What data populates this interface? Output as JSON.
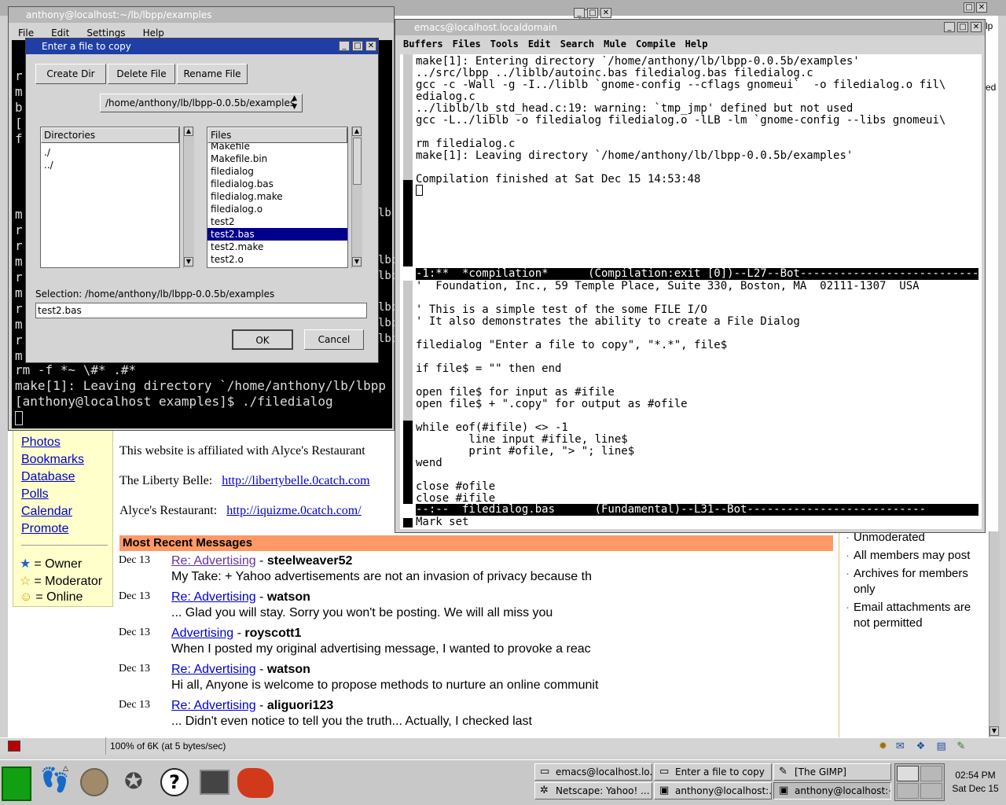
{
  "terminal": {
    "title": "anthony@localhost:~/lb/lbpp/examples",
    "menu": [
      "File",
      "Edit",
      "Settings",
      "Help"
    ],
    "left_chars": [
      "r",
      "m",
      "b",
      "[",
      "f",
      "m",
      "r",
      "r",
      "m",
      "r",
      "m",
      "r",
      "m",
      "r",
      "m"
    ],
    "right_fragments": [
      "lb",
      "lbp",
      "lbp",
      "lbp",
      "lbp",
      "lbp"
    ],
    "lines": [
      "rm -f *~ \\#* .#*",
      "make[1]: Leaving directory `/home/anthony/lb/lbpp",
      "[anthony@localhost examples]$ ./filedialog"
    ]
  },
  "dialog": {
    "title": "Enter a file to copy",
    "buttons": [
      "Create Dir",
      "Delete File",
      "Rename File"
    ],
    "path_select": "/home/anthony/lb/lbpp-0.0.5b/examples",
    "dirs_header": "Directories",
    "dirs": [
      "./",
      "../"
    ],
    "files_header": "Files",
    "files": [
      "Makefile",
      "Makefile.bin",
      "filedialog",
      "filedialog.bas",
      "filedialog.make",
      "filedialog.o",
      "test2",
      "test2.bas",
      "test2.make",
      "test2.o"
    ],
    "selected_file": "test2.bas",
    "selection_label": "Selection: /home/anthony/lb/lbpp-0.0.5b/examples",
    "selection_value": "test2.bas",
    "ok": "OK",
    "cancel": "Cancel"
  },
  "emacs": {
    "title": "emacs@localhost.localdomain",
    "menu": [
      "Buffers",
      "Files",
      "Tools",
      "Edit",
      "Search",
      "Mule",
      "Compile",
      "Help"
    ],
    "compile_lines": [
      "make[1]: Entering directory `/home/anthony/lb/lbpp-0.0.5b/examples'",
      "../src/lbpp ../liblb/autoinc.bas filedialog.bas filedialog.c",
      "gcc -c -Wall -g -I../liblb `gnome-config --cflags gnomeui`  -o filedialog.o fil\\",
      "edialog.c",
      "../liblb/lb_std_head.c:19: warning: `tmp_jmp' defined but not used",
      "gcc -L../liblb -o filedialog filedialog.o -lLB -lm `gnome-config --libs gnomeui\\",
      "",
      "rm filedialog.c",
      "make[1]: Leaving directory `/home/anthony/lb/lbpp-0.0.5b/examples'",
      "",
      "Compilation finished at Sat Dec 15 14:53:48"
    ],
    "modeline1": "-1:**  *compilation*      (Compilation:exit [0])--L27--Bot---------------------------",
    "code_lines": [
      "'  Foundation, Inc., 59 Temple Place, Suite 330, Boston, MA  02111-1307  USA",
      "",
      "' This is a simple test of the some FILE I/O",
      "' It also demonstrates the ability to create a File Dialog",
      "",
      "filedialog \"Enter a file to copy\", \"*.*\", file$",
      "",
      "if file$ = \"\" then end",
      "",
      "open file$ for input as #ifile",
      "open file$ + \".copy\" for output as #ofile",
      "",
      "while eof(#ifile) <> -1",
      "        line input #ifile, line$",
      "        print #ofile, \"> \"; line$",
      "wend",
      "",
      "close #ofile",
      "close #ifile"
    ],
    "modeline2": "--:--  filedialog.bas      (Fundamental)--L31--Bot---------------------------",
    "minibuffer": "Mark set"
  },
  "netscape": {
    "nav_links": [
      "Photos",
      "Bookmarks",
      "Database",
      "Polls",
      "Calendar",
      "Promote"
    ],
    "legend": [
      {
        "icon": "★",
        "color": "#1f5fd8",
        "label": "= Owner"
      },
      {
        "icon": "☆",
        "color": "#c8a000",
        "label": "= Moderator"
      },
      {
        "icon": "☺",
        "color": "#c8a000",
        "label": "= Online"
      }
    ],
    "affiliation": "This website is affiliated with Alyce's Restaurant",
    "liberty_label": "The Liberty Belle:",
    "liberty_url": "http://libertybelle.0catch.com",
    "alyce_label": "Alyce's Restaurant:",
    "alyce_url": "http://iquizme.0catch.com/",
    "messages_header": "Most Recent Messages",
    "messages": [
      {
        "date": "Dec 13",
        "subject": "Re: Advertising",
        "author": "steelweaver52",
        "preview": "My Take: + Yahoo advertisements are not an invasion of privacy because th"
      },
      {
        "date": "Dec 13",
        "subject": "Re: Advertising",
        "author": "watson",
        "preview": "... Glad you will stay. Sorry you won't be posting. We will all miss you"
      },
      {
        "date": "Dec 13",
        "subject": "Advertising",
        "author": "royscott1",
        "preview": "When I posted my original advertising message, I wanted to provoke a reac"
      },
      {
        "date": "Dec 13",
        "subject": "Re: Advertising",
        "author": "watson",
        "preview": "Hi all, Anyone is welcome to propose methods to nurture an online communit"
      },
      {
        "date": "Dec 13",
        "subject": "Re: Advertising",
        "author": "aliguori123",
        "preview": "... Didn't even notice to tell you the truth... Actually, I checked last"
      }
    ],
    "sidebar_items": [
      "Unmoderated",
      "All members may post",
      "Archives for members only",
      "Email attachments are not permitted"
    ],
    "right_frag_top": "lp",
    "right_frag_mid": "ed",
    "status": "100% of 6K (at 5 bytes/sec)"
  },
  "taskbar": {
    "tasks_row1": [
      "emacs@localhost.lo...",
      "Enter a file to copy",
      "[The GIMP]"
    ],
    "tasks_row2": [
      "Netscape: Yahoo! ...",
      "anthony@localhost:...",
      "anthony@localhost:~"
    ],
    "time": "02:54 PM",
    "date": "Sat Dec 15"
  }
}
